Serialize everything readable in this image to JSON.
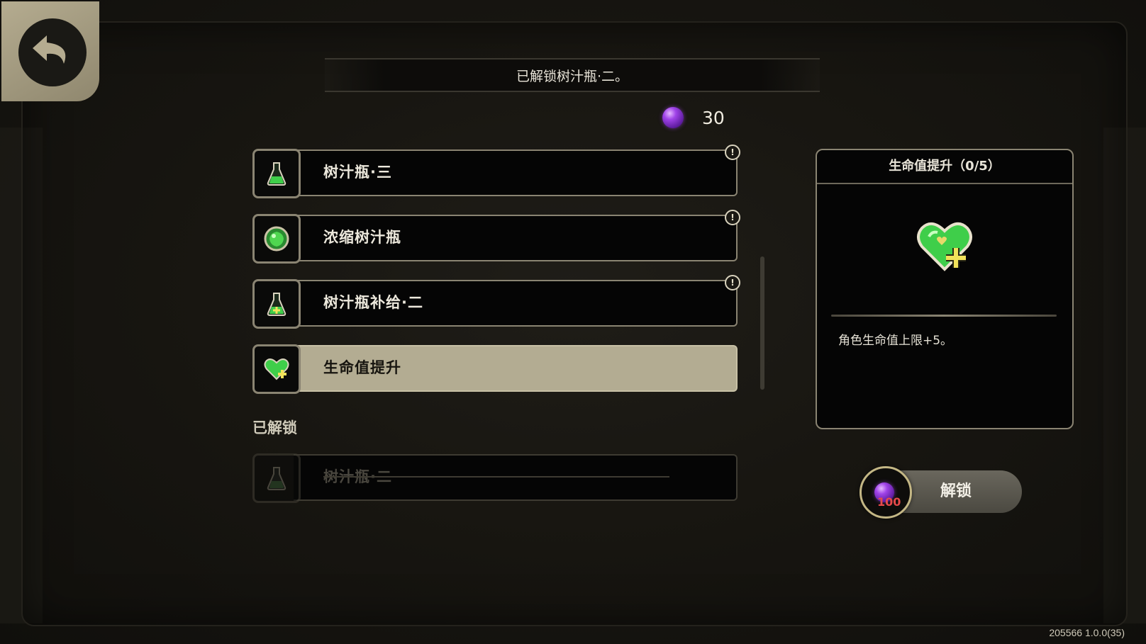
{
  "header": {
    "title": "已解锁树汁瓶·二。"
  },
  "currency": {
    "icon": "purple-orb-icon",
    "amount": "30"
  },
  "upgrades": [
    {
      "label": "树汁瓶·三",
      "icon": "flask-icon",
      "alert": "!"
    },
    {
      "label": "浓缩树汁瓶",
      "icon": "green-gem-icon",
      "alert": "!"
    },
    {
      "label": "树汁瓶补给·二",
      "icon": "flask-plus-icon",
      "alert": "!"
    },
    {
      "label": "生命值提升",
      "icon": "heart-plus-icon"
    }
  ],
  "unlocked_section": {
    "title": "已解锁",
    "items": [
      {
        "label": "树汁瓶·二",
        "icon": "flask-icon"
      }
    ]
  },
  "detail": {
    "title": "生命值提升（0/5）",
    "icon": "heart-plus-icon",
    "description": "角色生命值上限+5。"
  },
  "unlock_button": {
    "cost": "100",
    "label": "解锁"
  },
  "version": "205566 1.0.0(35)",
  "colors": {
    "accent_border": "#8a8472",
    "selected_row": "#b3ac92",
    "cost_red": "#e64a4a",
    "orb_purple": "#a043e8",
    "heart_green": "#3fce4a"
  }
}
